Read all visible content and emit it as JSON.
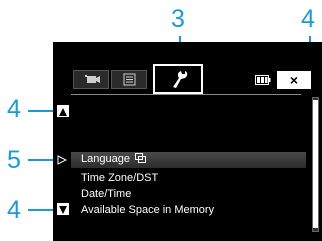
{
  "callouts": {
    "c3": "3",
    "c4_right": "4",
    "c4_top": "4",
    "c5": "5",
    "c4_bottom": "4"
  },
  "tabs": [
    {
      "name": "movie",
      "icon": "movie-camera-icon"
    },
    {
      "name": "list",
      "icon": "list-icon"
    },
    {
      "name": "setup",
      "icon": "wrench-icon",
      "active": true
    }
  ],
  "header": {
    "battery_icon": "battery-icon",
    "close_label": "×"
  },
  "menu": {
    "items": [
      {
        "label": "Language",
        "selected": true,
        "icon": "language-icon"
      },
      {
        "label": "Time Zone/DST"
      },
      {
        "label": "Date/Time"
      },
      {
        "label": "Available Space in Memory"
      }
    ]
  },
  "colors": {
    "callout": "#1b9ad6",
    "screen_bg": "#000000",
    "text": "#ffffff"
  }
}
